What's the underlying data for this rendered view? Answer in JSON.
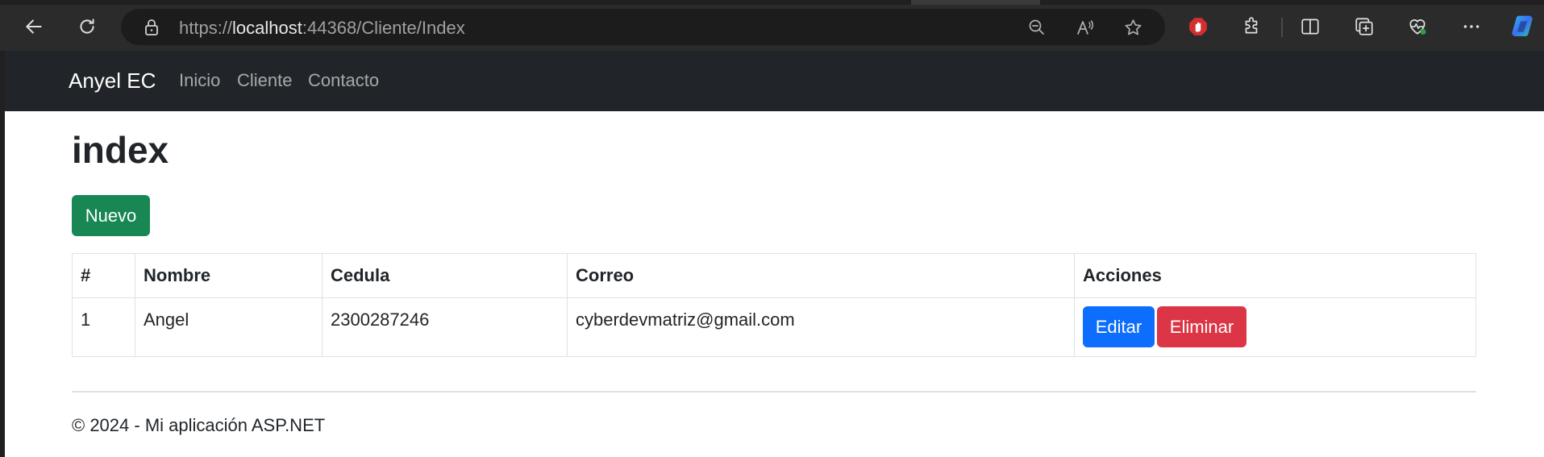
{
  "browser": {
    "url_scheme": "https://",
    "url_host": "localhost",
    "url_rest": ":44368/Cliente/Index",
    "icons": {
      "back": "arrow-left-icon",
      "refresh": "refresh-icon",
      "lock": "lock-icon",
      "zoom": "zoom-out-icon",
      "read_aloud": "read-aloud-icon",
      "favorite": "star-icon",
      "adblock": "adblock-icon",
      "extensions": "puzzle-icon",
      "split": "split-screen-icon",
      "collections": "collections-icon",
      "health": "browser-essentials-icon",
      "menu": "more-icon",
      "copilot": "copilot-icon"
    }
  },
  "navbar": {
    "brand": "Anyel EC",
    "links": [
      "Inicio",
      "Cliente",
      "Contacto"
    ]
  },
  "main": {
    "title": "index",
    "new_button": "Nuevo",
    "table": {
      "headers": [
        "#",
        "Nombre",
        "Cedula",
        "Correo",
        "Acciones"
      ],
      "rows": [
        {
          "id": "1",
          "nombre": "Angel",
          "cedula": "2300287246",
          "correo": "cyberdevmatriz@gmail.com",
          "edit": "Editar",
          "delete": "Eliminar"
        }
      ]
    }
  },
  "footer": {
    "text": "© 2024 - Mi aplicación ASP.NET"
  },
  "colors": {
    "navbar_bg": "#212529",
    "success": "#198754",
    "primary": "#0d6efd",
    "danger": "#dc3545",
    "adblock": "#d32f2f"
  }
}
